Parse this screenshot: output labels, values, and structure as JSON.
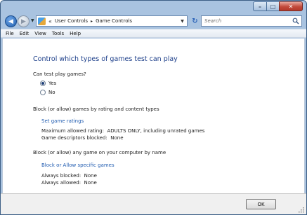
{
  "window": {
    "caption_buttons": {
      "minimize": "–",
      "maximize": "□",
      "close": "✕"
    }
  },
  "navigation": {
    "address_chevron": "«",
    "breadcrumb": [
      "User Controls",
      "Game Controls"
    ],
    "breadcrumb_separator": "▸",
    "search_placeholder": "Search"
  },
  "menu": {
    "items": [
      "File",
      "Edit",
      "View",
      "Tools",
      "Help"
    ]
  },
  "main": {
    "title": "Control which types of games test can play",
    "can_play_question": "Can test play games?",
    "options": [
      {
        "label": "Yes",
        "selected": true
      },
      {
        "label": "No",
        "selected": false
      }
    ],
    "rating_heading": "Block (or allow) games by rating and content types",
    "set_ratings_link": "Set game ratings",
    "max_rating_label": "Maximum allowed rating:",
    "max_rating_value": "ADULTS ONLY, including unrated games",
    "descriptors_label": "Game descriptors blocked:",
    "descriptors_value": "None",
    "by_name_heading": "Block (or allow) any game on your computer by name",
    "specific_games_link": "Block or Allow specific games",
    "always_blocked_label": "Always blocked:",
    "always_blocked_value": "None",
    "always_allowed_label": "Always allowed:",
    "always_allowed_value": "None"
  },
  "footer": {
    "ok_label": "OK"
  },
  "colors": {
    "title_blue": "#1d3f8a",
    "link_blue": "#1f5bb0",
    "frame_blue": "#a9c3e0",
    "close_red": "#c24a3b"
  }
}
